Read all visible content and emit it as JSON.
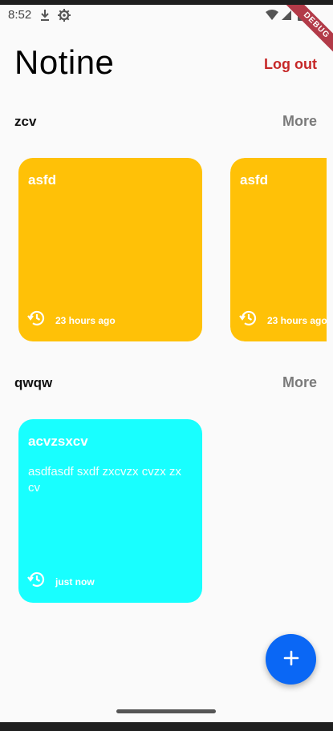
{
  "status_bar": {
    "time": "8:52",
    "icons_left": [
      "download-icon",
      "settings-icon"
    ],
    "icons_right": [
      "wifi-icon",
      "signal-icon",
      "battery-icon"
    ]
  },
  "debug_banner": "DEBUG",
  "app": {
    "title": "Notine",
    "logout_label": "Log out",
    "accent_color": "#c62828"
  },
  "sections": [
    {
      "title": "zcv",
      "more_label": "More",
      "notes": [
        {
          "title": "asfd",
          "body": "",
          "time": "23 hours ago",
          "color": "#ffc107"
        },
        {
          "title": "asfd",
          "body": "",
          "time": "23 hours ago",
          "color": "#ffc107"
        }
      ]
    },
    {
      "title": "qwqw",
      "more_label": "More",
      "notes": [
        {
          "title": "acvzsxcv",
          "body": "asdfasdf sxdf zxcvzx cvzx zx cv",
          "time": "just now",
          "color": "#18ffff"
        }
      ]
    }
  ],
  "fab": {
    "icon": "plus-icon",
    "color": "#0a67f5"
  }
}
